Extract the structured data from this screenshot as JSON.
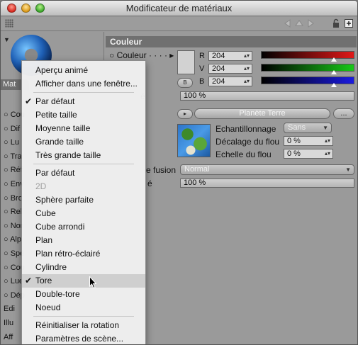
{
  "window": {
    "title": "Modificateur de matériaux"
  },
  "left": {
    "tab": "Mat",
    "items": [
      "Cou",
      "Dif",
      "Lu",
      "Tra",
      "Réf",
      "Env",
      "Bro",
      "Rel",
      "Nor",
      "Alp",
      "Spé",
      "Cou",
      "Lue",
      "Dép",
      "Edi",
      "Illu",
      "Aff"
    ]
  },
  "section": {
    "title": "Couleur"
  },
  "color": {
    "label": "Couleur",
    "rows": [
      {
        "channel": "R",
        "value": "204",
        "color": "#e01818"
      },
      {
        "channel": "V",
        "value": "204",
        "color": "#18c818"
      },
      {
        "channel": "B",
        "value": "204",
        "color": "#1a1ae0"
      }
    ],
    "b_button": "B"
  },
  "brightness": {
    "label": "é",
    "value": "100 %"
  },
  "texture": {
    "name": "Planète Terre",
    "more": "...",
    "sampling_label": "Echantillonnage",
    "sampling_value": "Sans",
    "blur_offset_label": "Décalage du flou",
    "blur_offset_value": "0 %",
    "blur_scale_label": "Echelle du flou",
    "blur_scale_value": "0 %"
  },
  "mix": {
    "label": "e fusion",
    "value": "Normal"
  },
  "mix_strength": {
    "label": "é",
    "value": "100 %"
  },
  "menu": {
    "groups": [
      [
        {
          "label": "Aperçu animé"
        },
        {
          "label": "Afficher dans une fenêtre..."
        }
      ],
      [
        {
          "label": "Par défaut",
          "checked": true
        },
        {
          "label": "Petite taille"
        },
        {
          "label": "Moyenne taille"
        },
        {
          "label": "Grande taille"
        },
        {
          "label": "Très grande taille"
        }
      ],
      [
        {
          "label": "Par défaut"
        },
        {
          "label": "2D",
          "disabled": true
        },
        {
          "label": "Sphère parfaite"
        },
        {
          "label": "Cube"
        },
        {
          "label": "Cube arrondi"
        },
        {
          "label": "Plan"
        },
        {
          "label": "Plan rétro-éclairé"
        },
        {
          "label": "Cylindre"
        },
        {
          "label": "Tore",
          "checked": true,
          "selected": true
        },
        {
          "label": "Double-tore"
        },
        {
          "label": "Noeud"
        }
      ],
      [
        {
          "label": "Réinitialiser la rotation"
        },
        {
          "label": "Paramètres de scène..."
        }
      ]
    ]
  }
}
